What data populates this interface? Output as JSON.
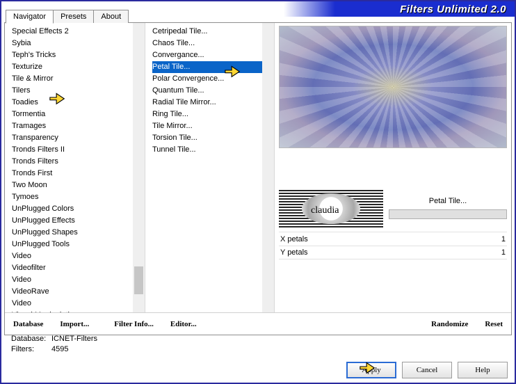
{
  "title": "Filters Unlimited 2.0",
  "tabs": [
    "Navigator",
    "Presets",
    "About"
  ],
  "active_tab": 0,
  "categories": [
    "Special Effects 2",
    "Sybia",
    "Teph's Tricks",
    "Texturize",
    "Tile & Mirror",
    "Tilers",
    "Toadies",
    "Tormentia",
    "Tramages",
    "Transparency",
    "Tronds Filters II",
    "Tronds Filters",
    "Tronds First",
    "Two Moon",
    "Tymoes",
    "UnPlugged Colors",
    "UnPlugged Effects",
    "UnPlugged Shapes",
    "UnPlugged Tools",
    "Video",
    "Videofilter",
    "Video",
    "VideoRave",
    "Video",
    "Visual Manipulation"
  ],
  "selected_category_index": 5,
  "filters": [
    "Cetripedal Tile...",
    "Chaos Tile...",
    "Convergance...",
    "Petal Tile...",
    "Polar Convergence...",
    "Quantum Tile...",
    "Radial Tile Mirror...",
    "Ring Tile...",
    "Tile Mirror...",
    "Torsion Tile...",
    "Tunnel Tile..."
  ],
  "selected_filter_index": 3,
  "current_filter_label": "Petal Tile...",
  "params": [
    {
      "name": "X petals",
      "value": "1"
    },
    {
      "name": "Y petals",
      "value": "1"
    }
  ],
  "bottom_buttons": {
    "database": "Database",
    "import": "Import...",
    "filter_info": "Filter Info...",
    "editor": "Editor...",
    "randomize": "Randomize",
    "reset": "Reset"
  },
  "status": {
    "db_label": "Database:",
    "db_value": "ICNET-Filters",
    "filters_label": "Filters:",
    "filters_value": "4595"
  },
  "actions": {
    "apply": "Apply",
    "cancel": "Cancel",
    "help": "Help"
  },
  "watermark_text": "claudia"
}
